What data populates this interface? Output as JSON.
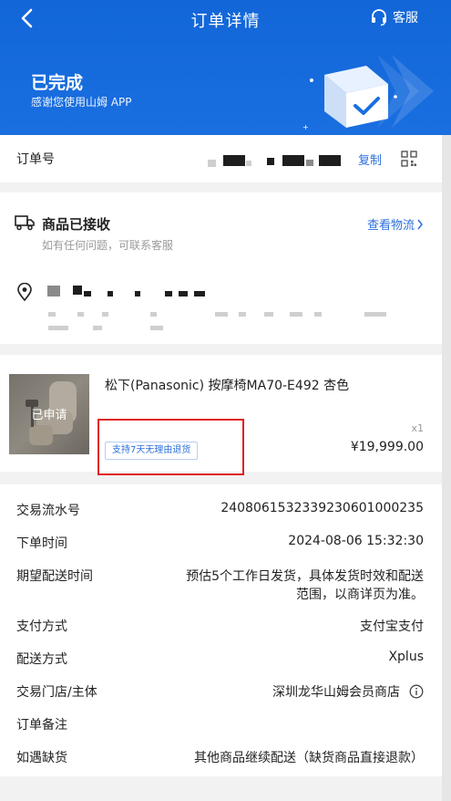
{
  "header": {
    "title": "订单详情",
    "service_label": "客服",
    "status": "已完成",
    "subtitle": "感谢您使用山姆 APP"
  },
  "order": {
    "label": "订单号",
    "copy_label": "复制"
  },
  "delivery": {
    "title": "商品已接收",
    "hint": "如有任何问题，可联系客服",
    "track_label": "查看物流"
  },
  "product": {
    "name": "松下(Panasonic) 按摩椅MA70-E492 杏色",
    "stamp": "已申请",
    "tag": "支持7天无理由退货",
    "qty": "x1",
    "price": "¥19,999.00"
  },
  "details": [
    {
      "key": "交易流水号",
      "value": "2408061532339230601000235"
    },
    {
      "key": "下单时间",
      "value": "2024-08-06 15:32:30"
    },
    {
      "key": "期望配送时间",
      "value_line1": "预估5个工作日发货，具体发货时效和配送",
      "value_line2": "范围，以商详页为准。"
    },
    {
      "key": "支付方式",
      "value": "支付宝支付"
    },
    {
      "key": "配送方式",
      "value": "Xplus"
    },
    {
      "key": "交易门店/主体",
      "value": "深圳龙华山姆会员商店"
    },
    {
      "key": "订单备注",
      "value": ""
    },
    {
      "key": "如遇缺货",
      "value": "其他商品继续配送（缺货商品直接退款）"
    }
  ],
  "colors": {
    "brand_blue": "#1266d8",
    "link_blue": "#2b6fdc",
    "highlight_red": "#e02020"
  }
}
